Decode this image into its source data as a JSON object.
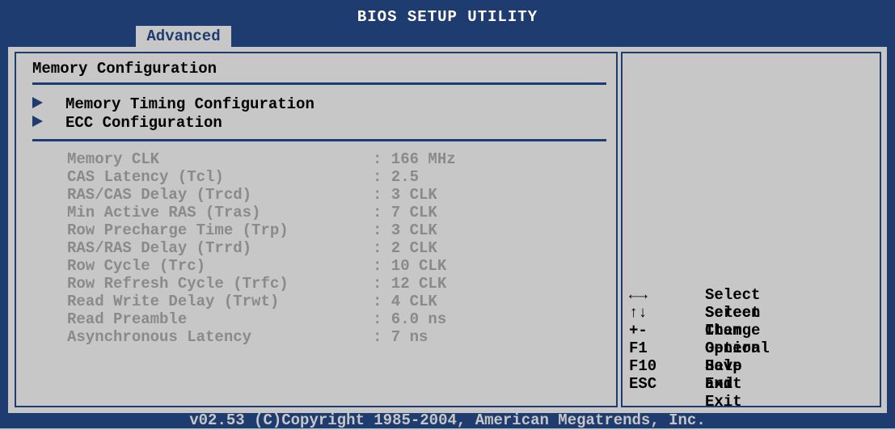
{
  "app": {
    "title": "BIOS SETUP UTILITY",
    "active_tab": "Advanced"
  },
  "main": {
    "section_title": "Memory Configuration",
    "submenus": [
      {
        "label": "Memory Timing Configuration"
      },
      {
        "label": "ECC Configuration"
      }
    ],
    "info_rows": [
      {
        "label": "Memory CLK",
        "value": ": 166 MHz"
      },
      {
        "label": "CAS Latency (Tcl)",
        "value": ": 2.5"
      },
      {
        "label": "RAS/CAS Delay (Trcd)",
        "value": ": 3 CLK"
      },
      {
        "label": "Min Active RAS (Tras)",
        "value": ": 7 CLK"
      },
      {
        "label": "Row Precharge Time (Trp)",
        "value": ": 3 CLK"
      },
      {
        "label": "RAS/RAS Delay (Trrd)",
        "value": ": 2 CLK"
      },
      {
        "label": "Row Cycle (Trc)",
        "value": ": 10 CLK"
      },
      {
        "label": "Row Refresh Cycle (Trfc)",
        "value": ": 12 CLK"
      },
      {
        "label": "Read Write Delay (Trwt)",
        "value": ": 4 CLK"
      },
      {
        "label": "Read Preamble",
        "value": ": 6.0 ns"
      },
      {
        "label": "Asynchronous Latency",
        "value": ": 7 ns"
      }
    ]
  },
  "help": {
    "keys": [
      {
        "key": "←→",
        "desc": "Select Screen"
      },
      {
        "key": "↑↓",
        "desc": "Select Item"
      },
      {
        "key": "+-",
        "desc": "Change Option"
      },
      {
        "key": "F1",
        "desc": "General Help"
      },
      {
        "key": "F10",
        "desc": "Save and Exit"
      },
      {
        "key": "ESC",
        "desc": "Exit"
      }
    ]
  },
  "footer": {
    "copyright": "v02.53 (C)Copyright 1985-2004, American Megatrends, Inc."
  },
  "colors": {
    "frame": "#1e3c6f",
    "background": "#c7c7c7",
    "text": "#000000",
    "disabled_text": "#8a8a8a"
  }
}
